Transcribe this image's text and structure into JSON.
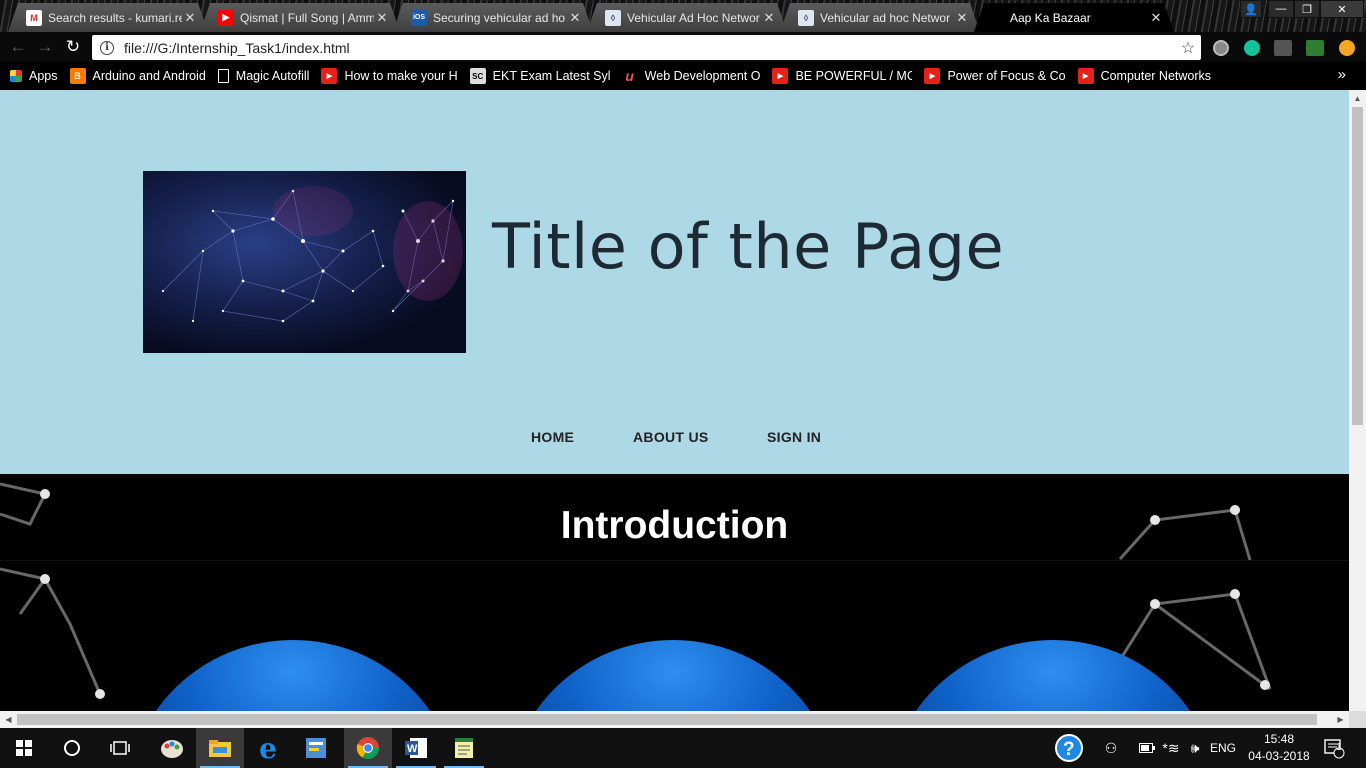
{
  "browser": {
    "tabs": [
      {
        "title": "Search results - kumari.re",
        "icon": "gmail-icon",
        "color": "#d93025",
        "glyph": "M",
        "active": false
      },
      {
        "title": "Qismat | Full Song | Amm",
        "icon": "youtube-icon",
        "color": "#ff0000",
        "glyph": "▶",
        "active": false
      },
      {
        "title": "Securing vehicular ad ho",
        "icon": "ios-icon",
        "color": "#1e5aa8",
        "glyph": "iOS",
        "active": false
      },
      {
        "title": "Vehicular Ad Hoc Networ",
        "icon": "document-icon",
        "color": "#3b4a6b",
        "glyph": "✂",
        "active": false
      },
      {
        "title": "Vehicular ad hoc Networ",
        "icon": "document-icon",
        "color": "#3b4a6b",
        "glyph": "✂",
        "active": false
      },
      {
        "title": "Aap Ka Bazaar",
        "icon": "",
        "color": "#000000",
        "glyph": "",
        "active": true
      }
    ],
    "url": "file:///G:/Internship_Task1/index.html",
    "bookmarks": [
      {
        "label": "Apps",
        "icon": "apps-grid-icon",
        "color": "#e53935"
      },
      {
        "label": "Arduino and Android",
        "icon": "blogger-icon",
        "color": "#f57c00"
      },
      {
        "label": "Magic Autofill",
        "icon": "page-icon",
        "color": "#ffffff"
      },
      {
        "label": "How to make your H",
        "icon": "youtube-icon",
        "color": "#e62117"
      },
      {
        "label": "EKT Exam Latest Sylla",
        "icon": "sc-icon",
        "color": "#dddddd"
      },
      {
        "label": "Web Development O",
        "icon": "udemy-icon",
        "color": "#ec5252"
      },
      {
        "label": "BE POWERFUL / MOT",
        "icon": "youtube-icon",
        "color": "#e62117"
      },
      {
        "label": "Power of Focus & Co",
        "icon": "youtube-icon",
        "color": "#e62117"
      },
      {
        "label": "Computer Networks",
        "icon": "youtube-icon",
        "color": "#e62117"
      }
    ]
  },
  "page": {
    "title": "Title of the Page",
    "menu": [
      "HOME",
      "ABOUT US",
      "SIGN IN"
    ],
    "intro_heading": "Introduction",
    "header_bg": "#add8e6",
    "dome_color": "#0f62c9"
  },
  "taskbar": {
    "apps": [
      "windows-start-icon",
      "cortana-search-icon",
      "task-view-icon",
      "paint-icon",
      "file-explorer-icon",
      "edge-icon",
      "notepad-plus-icon",
      "chrome-icon",
      "word-icon",
      "notepad-icon"
    ],
    "language": "ENG",
    "time": "15:48",
    "date": "04-03-2018",
    "notification_count": "1"
  }
}
